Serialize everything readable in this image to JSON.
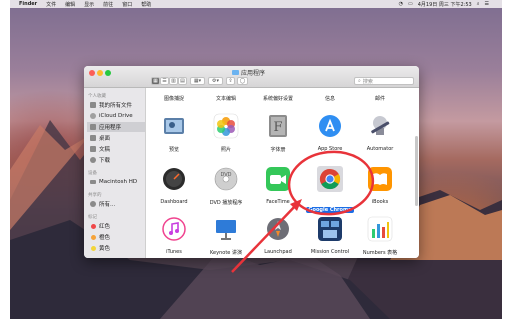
{
  "menubar": {
    "app_name": "Finder",
    "menus": [
      "文件",
      "编辑",
      "显示",
      "前往",
      "窗口",
      "帮助"
    ],
    "clock": "4月19日 周三 下午2:53"
  },
  "window": {
    "title": "应用程序"
  },
  "search": {
    "placeholder": "搜索"
  },
  "sidebar": {
    "personal_header": "个人收藏",
    "personal": [
      "我的所有文件",
      "iCloud Drive",
      "应用程序",
      "桌面",
      "文稿",
      "下载"
    ],
    "devices_header": "设备",
    "device": "Macintosh HD",
    "shared_header": "共享的",
    "shared": "所有...",
    "tags_header": "标记",
    "tags": [
      {
        "label": "红色",
        "color": "#f0484a"
      },
      {
        "label": "橙色",
        "color": "#f5a33a"
      },
      {
        "label": "黄色",
        "color": "#f2d53a"
      }
    ]
  },
  "top_labels": [
    "图像捕捉",
    "文本编辑",
    "系统偏好设置",
    "信息",
    "邮件"
  ],
  "row1": [
    "预览",
    "照片",
    "字体册",
    "App Store",
    "Automator"
  ],
  "row2": [
    "Dashboard",
    "DVD 播放程序",
    "FaceTime",
    "Google Chrome",
    "iBooks"
  ],
  "row3": [
    "iTunes",
    "Keynote 讲演",
    "Launchpad",
    "Mission Control",
    "Numbers 表格"
  ],
  "colors": {
    "accent": "#1b6ee6",
    "annotation": "#e8333a"
  }
}
